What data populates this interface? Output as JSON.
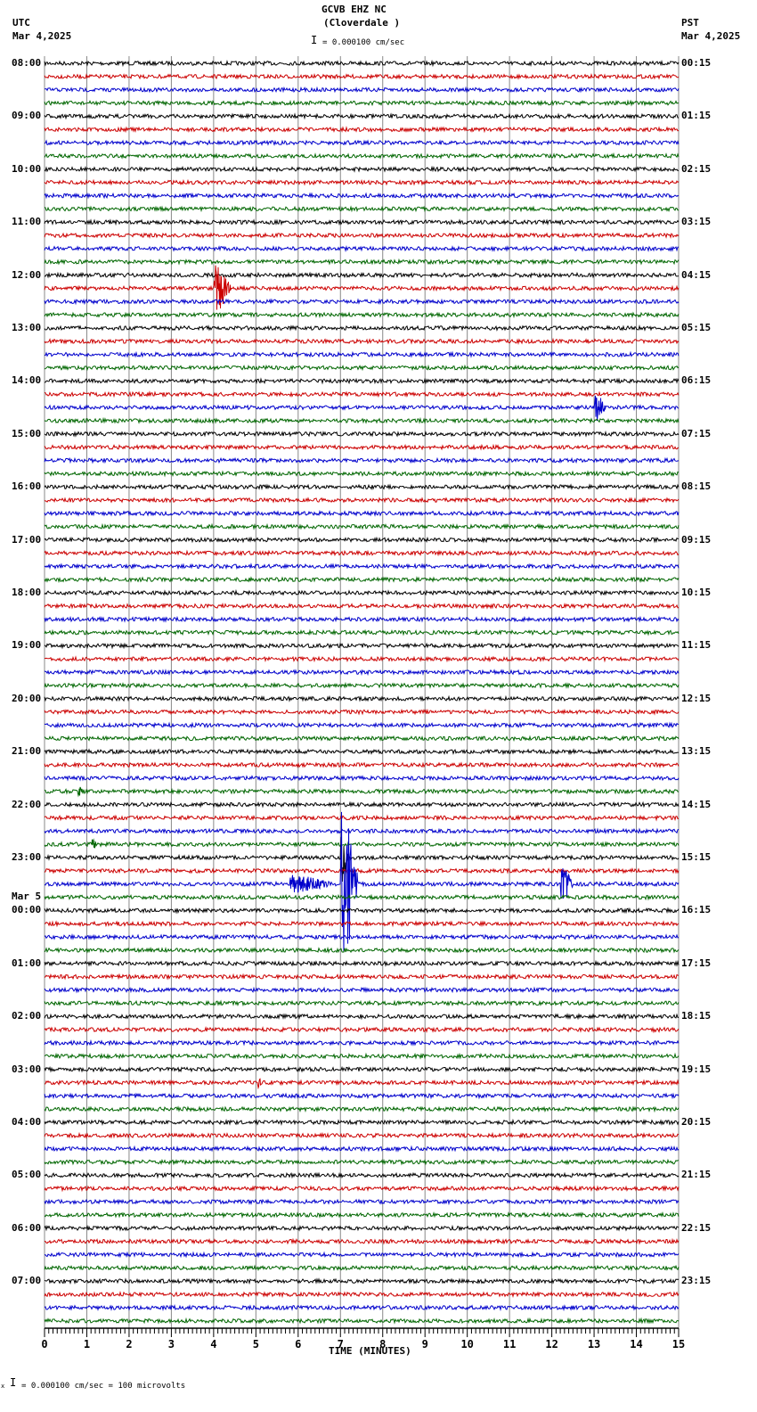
{
  "header": {
    "station": "GCVB EHZ NC",
    "location": "(Cloverdale )",
    "left_tz": "UTC",
    "left_date": "Mar 4,2025",
    "right_tz": "PST",
    "right_date": "Mar 4,2025",
    "scale": "= 0.000100 cm/sec"
  },
  "footer": {
    "scale": "= 0.000100 cm/sec =     100 microvolts",
    "prefix": "x"
  },
  "chart_data": {
    "type": "line",
    "title": "GCVB EHZ NC (Cloverdale )",
    "xlabel": "TIME (MINUTES)",
    "xlim": [
      0,
      15
    ],
    "x_ticks": [
      "0",
      "1",
      "2",
      "3",
      "4",
      "5",
      "6",
      "7",
      "8",
      "9",
      "10",
      "11",
      "12",
      "13",
      "14",
      "15"
    ],
    "trace_count": 96,
    "trace_minutes": 15,
    "colors": [
      "#000000",
      "#cc0000",
      "#0000cc",
      "#006600"
    ],
    "left_labels": [
      "08:00",
      "09:00",
      "10:00",
      "11:00",
      "12:00",
      "13:00",
      "14:00",
      "15:00",
      "16:00",
      "17:00",
      "18:00",
      "19:00",
      "20:00",
      "21:00",
      "22:00",
      "23:00",
      "00:00",
      "01:00",
      "02:00",
      "03:00",
      "04:00",
      "05:00",
      "06:00",
      "07:00"
    ],
    "date_change": {
      "label": "Mar 5",
      "at_hour_index": 16
    },
    "right_labels": [
      "00:15",
      "01:15",
      "02:15",
      "03:15",
      "04:15",
      "05:15",
      "06:15",
      "07:15",
      "08:15",
      "09:15",
      "10:15",
      "11:15",
      "12:15",
      "13:15",
      "14:15",
      "15:15",
      "16:15",
      "17:15",
      "18:15",
      "19:15",
      "20:15",
      "21:15",
      "22:15",
      "23:15"
    ],
    "events": [
      {
        "trace": 17,
        "start_min": 4.0,
        "end_min": 4.4,
        "amplitude": 27
      },
      {
        "trace": 20,
        "start_min": 8.6,
        "end_min": 8.8,
        "amplitude": 3
      },
      {
        "trace": 26,
        "start_min": 13.0,
        "end_min": 13.3,
        "amplitude": 15
      },
      {
        "trace": 55,
        "start_min": 0.8,
        "end_min": 1.0,
        "amplitude": 5
      },
      {
        "trace": 59,
        "start_min": 1.1,
        "end_min": 1.3,
        "amplitude": 6
      },
      {
        "trace": 60,
        "start_min": 7.0,
        "end_min": 7.2,
        "amplitude": 40
      },
      {
        "trace": 62,
        "start_min": 5.8,
        "end_min": 6.9,
        "amplitude": 10
      },
      {
        "trace": 62,
        "start_min": 7.0,
        "end_min": 7.4,
        "amplitude": 92
      },
      {
        "trace": 62,
        "start_min": 12.2,
        "end_min": 12.5,
        "amplitude": 22
      },
      {
        "trace": 77,
        "start_min": 5.05,
        "end_min": 5.15,
        "amplitude": 6
      },
      {
        "trace": 73,
        "start_min": 14.4,
        "end_min": 15.0,
        "amplitude": 3
      }
    ]
  }
}
